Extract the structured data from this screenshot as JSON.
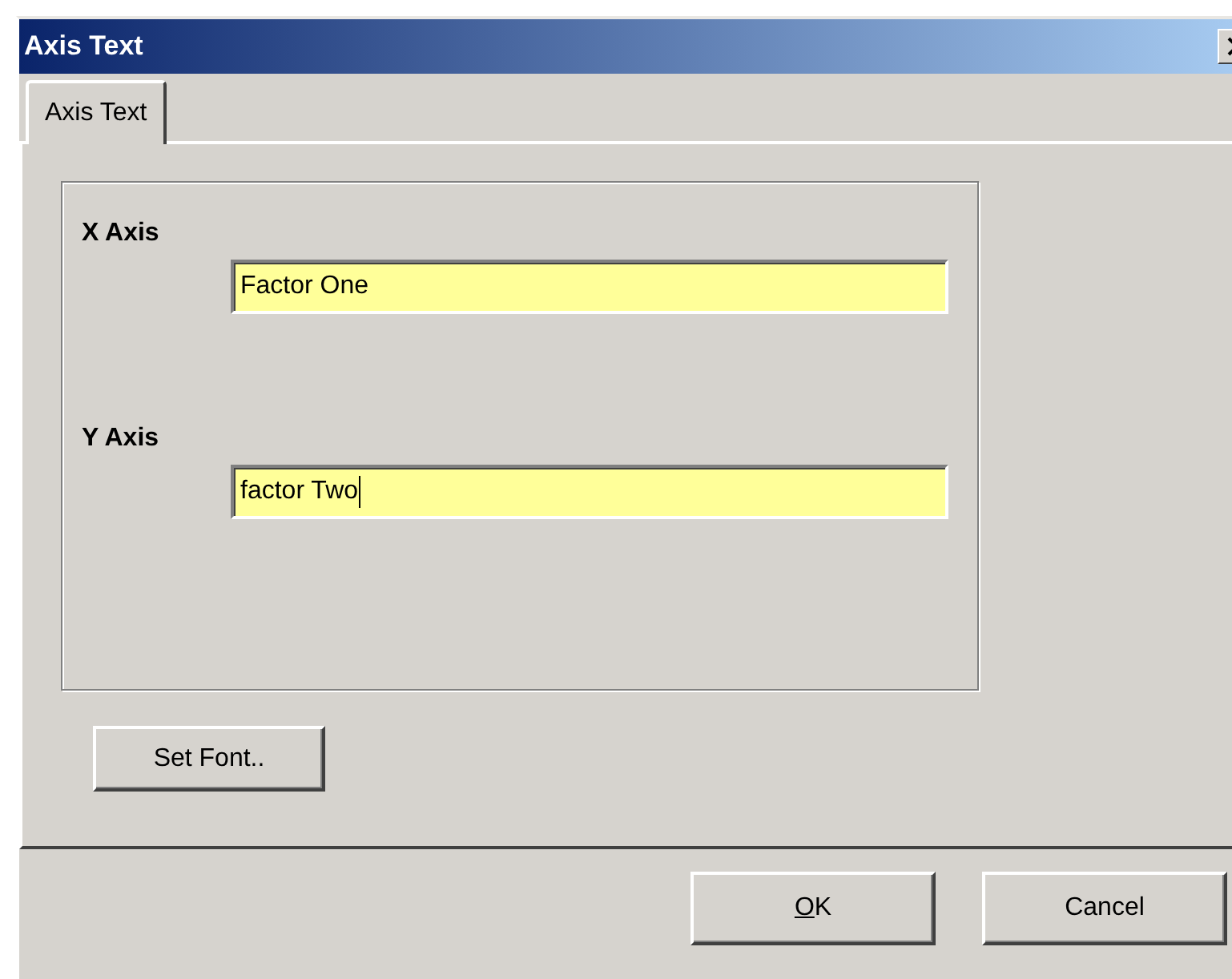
{
  "window": {
    "title": "Axis Text"
  },
  "tabs": [
    {
      "label": "Axis Text",
      "selected": true
    }
  ],
  "fields": [
    {
      "label": "X Axis",
      "value": "Factor One",
      "focused": false
    },
    {
      "label": "Y Axis",
      "value": "factor Two",
      "focused": true
    }
  ],
  "set_font_button": {
    "label": "Set Font.."
  },
  "buttons": [
    {
      "label": "OK",
      "first_letter_underlined": true
    },
    {
      "label": "Cancel"
    }
  ]
}
